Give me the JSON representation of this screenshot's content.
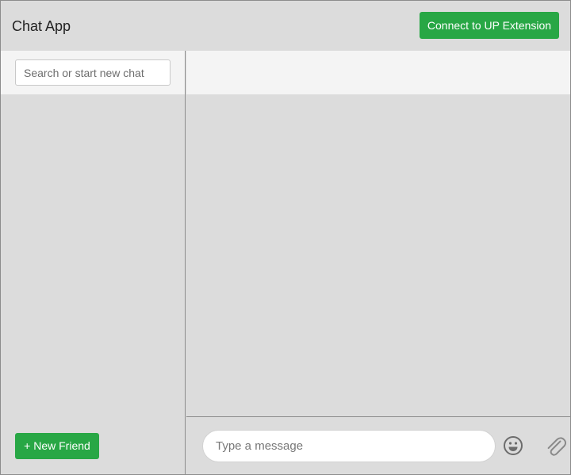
{
  "header": {
    "title": "Chat App",
    "connect_button_label": "Connect to UP Extension"
  },
  "sidebar": {
    "search": {
      "placeholder": "Search or start new chat",
      "value": ""
    },
    "new_friend_button_label": "+ New Friend"
  },
  "chat": {
    "composer": {
      "placeholder": "Type a message",
      "value": "",
      "emoji_icon": "emoji-icon",
      "attach_icon": "paperclip-icon"
    }
  },
  "colors": {
    "accent": "#28a745",
    "background": "#dcdcdc",
    "panel_header": "#f4f4f4",
    "border": "#8c8c8c"
  }
}
